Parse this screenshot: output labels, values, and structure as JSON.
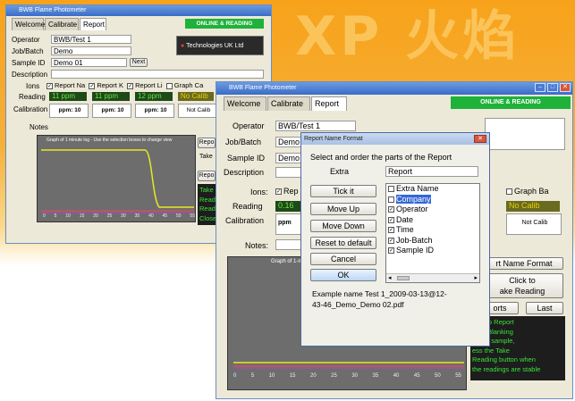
{
  "background": {
    "watermark": "XP 火焰光"
  },
  "back_window": {
    "title": "BWB Flame Photometer",
    "tabs": [
      "Welcome",
      "Calibrate",
      "Report"
    ],
    "status": "ONLINE & READING",
    "operator_label": "Operator",
    "operator_value": "BWB/Test 1",
    "job_label": "Job/Batch",
    "job_value": "Demo",
    "sample_label": "Sample ID",
    "sample_value": "Demo 01",
    "next_label": "Next",
    "description_label": "Description",
    "logo_text": "Technologies UK Ltd",
    "ions_label": "Ions",
    "ions": [
      "Report Na",
      "Report K",
      "Report Li",
      "Graph Ca"
    ],
    "reading_label": "Reading",
    "readings": [
      "11 ppm",
      "11 ppm",
      "12 ppm",
      "No Calib"
    ],
    "calibration_label": "Calibration",
    "calibrations": [
      "ppm: 10",
      "ppm: 10",
      "ppm: 10",
      "Not Calib"
    ],
    "notes_label": "Notes",
    "graph_title": "Graph of 1 minute log - Use the selection boxes to change view",
    "report_btn": "Repo",
    "take_text": "Take",
    "report_btn2": "Repo",
    "tip_lines": [
      "Take",
      "Read",
      "Read",
      "Close"
    ],
    "xticks": [
      "0",
      "5",
      "10",
      "15",
      "20",
      "25",
      "30",
      "35",
      "40",
      "45",
      "50",
      "55"
    ]
  },
  "front_window": {
    "title": "BWB Flame Photometer",
    "tabs": [
      "Welcome",
      "Calibrate",
      "Report"
    ],
    "status": "ONLINE & READING",
    "operator_label": "Operator",
    "operator_value": "BWB/Test 1",
    "job_label": "Job/Batch",
    "job_value": "Demo",
    "sample_label": "Sample ID",
    "sample_value": "Demo",
    "description_label": "Description",
    "ions_label": "Ions:",
    "ion_rep": "Rep",
    "graph_ba": "Graph Ba",
    "reading_label": "Reading",
    "reading_first": "0.16",
    "no_calib": "No Calib",
    "calibration_label": "Calibration",
    "calib_first": "ppm",
    "not_calib": "Not Calib",
    "notes_label": "Notes:",
    "graph_title": "Graph of 1-m",
    "report_name_format_btn": "rt Name Format",
    "click_take_btn": [
      "Click to",
      "ake Reading"
    ],
    "reports_btn": "orts",
    "last_btn": "Last",
    "tip_lines": [
      "ions to Report",
      "after Blanking",
      "re the sample,",
      "ess the Take",
      "Reading button when",
      "the readings are stable"
    ],
    "xticks": [
      "0",
      "5",
      "10",
      "15",
      "20",
      "25",
      "30",
      "35",
      "40",
      "45",
      "50",
      "55"
    ]
  },
  "dialog": {
    "title": "Report Name Format",
    "instruction": "Select and order the parts of the Report",
    "extra_label": "Extra",
    "extra_value": "Report",
    "buttons": [
      "Tick it",
      "Move Up",
      "Move Down",
      "Reset to default",
      "Cancel",
      "OK"
    ],
    "items": [
      {
        "label": "Extra Name",
        "checked": false
      },
      {
        "label": "Company",
        "checked": false,
        "selected": true
      },
      {
        "label": "Operator",
        "checked": true
      },
      {
        "label": "Date",
        "checked": true
      },
      {
        "label": "Time",
        "checked": true
      },
      {
        "label": "Job-Batch",
        "checked": true
      },
      {
        "label": "Sample ID",
        "checked": true
      }
    ],
    "example_line1": "Example name  Test 1_2009-03-13@12-",
    "example_line2": "43-46_Demo_Demo 02.pdf"
  }
}
